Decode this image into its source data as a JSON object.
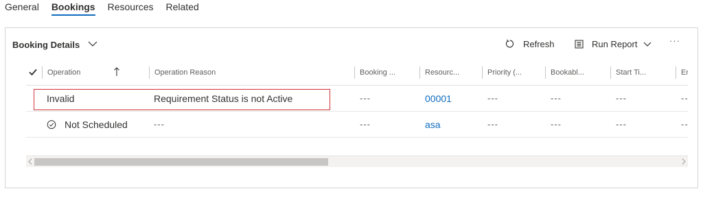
{
  "tabs": [
    {
      "label": "General"
    },
    {
      "label": "Bookings",
      "active": true
    },
    {
      "label": "Resources"
    },
    {
      "label": "Related"
    }
  ],
  "section": {
    "title": "Booking Details"
  },
  "toolbar": {
    "refresh_label": "Refresh",
    "run_report_label": "Run Report",
    "more_label": "···"
  },
  "grid": {
    "columns": [
      {
        "label": "Operation"
      },
      {
        "label": "Operation Reason"
      },
      {
        "label": "Booking ..."
      },
      {
        "label": "Resourc..."
      },
      {
        "label": "Priority (..."
      },
      {
        "label": "Bookabl..."
      },
      {
        "label": "Start Ti..."
      },
      {
        "label": "Er"
      }
    ],
    "rows": [
      {
        "operation": "Invalid",
        "reason": "Requirement Status is not Active",
        "booking": "---",
        "resource": "00001",
        "priority": "---",
        "bookable": "---",
        "start": "---",
        "end": "--"
      },
      {
        "operation": "Not Scheduled",
        "reason": "---",
        "booking": "---",
        "resource": "asa",
        "priority": "---",
        "bookable": "---",
        "start": "---",
        "end": "--"
      }
    ]
  },
  "colors": {
    "accent": "#0f6cbd",
    "highlight": "#d13438"
  }
}
